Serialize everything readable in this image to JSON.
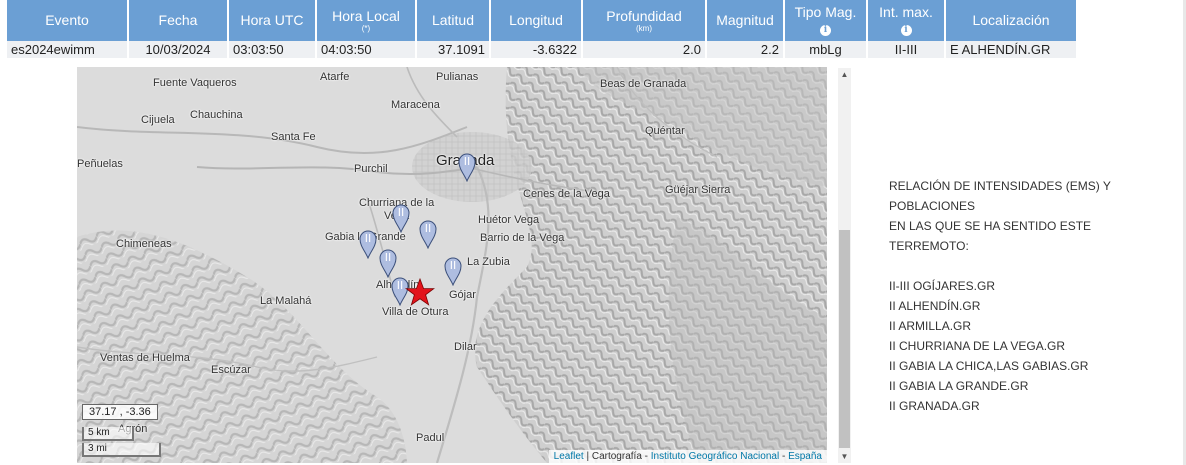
{
  "table": {
    "headers": {
      "evento": "Evento",
      "fecha": "Fecha",
      "hora_utc": "Hora UTC",
      "hora_local": "Hora Local",
      "hora_local_sub": "(*)",
      "latitud": "Latitud",
      "longitud": "Longitud",
      "profundidad": "Profundidad",
      "profundidad_sub": "(km)",
      "magnitud": "Magnitud",
      "tipo_mag": "Tipo Mag.",
      "int_max": "Int. max.",
      "localizacion": "Localización",
      "info_glyph": "i"
    },
    "row": {
      "evento": "es2024ewimm",
      "fecha": "10/03/2024",
      "hora_utc": "03:03:50",
      "hora_local": "04:03:50",
      "latitud": "37.1091",
      "longitud": "-3.6322",
      "profundidad": "2.0",
      "magnitud": "2.2",
      "tipo_mag": "mbLg",
      "int_max": "II-III",
      "localizacion": "E ALHENDÍN.GR"
    }
  },
  "map": {
    "places": {
      "fuente_vaqueros": "Fuente Vaqueros",
      "atarfe": "Atarfe",
      "pulianas": "Pulianas",
      "beas": "Beas de Granada",
      "maracena": "Maracena",
      "cijuela": "Cijuela",
      "chauchina": "Chauchina",
      "santa_fe": "Santa Fe",
      "quentar": "Quéntar",
      "penuelas": "Peñuelas",
      "purchil": "Purchil",
      "granada": "Granada",
      "cenes": "Cenes de la Vega",
      "guejar": "Güéjar Sierra",
      "churriana": "Churriana de la",
      "vega": "Vega",
      "huetor": "Huétor Vega",
      "chimeneas": "Chimeneas",
      "gabia": "Gabia la Grande",
      "barrio": "Barrio de la Vega",
      "zubia": "La Zubia",
      "alhendin": "Alhendín",
      "gojar": "Gójar",
      "malaha": "La Malahá",
      "otura": "Villa de Otura",
      "dilar": "Dilar",
      "ventas": "Ventas de Huelma",
      "escuzar": "Escúzar",
      "agron": "Agrón",
      "padul": "Padul"
    },
    "marker_label": "II",
    "coords": "37.17 , -3.36",
    "scale_km": "5 km",
    "scale_mi": "3 mi",
    "attribution": {
      "leaflet": "Leaflet",
      "sep": " | Cartografía - ",
      "ign": "Instituto Geográfico Nacional",
      "dash": " - ",
      "espana": "España"
    },
    "colors": {
      "marker": "#aebde0",
      "star": "#e3131b"
    }
  },
  "scrollbar": {
    "up_glyph": "▲",
    "down_glyph": "▼"
  },
  "intensities": {
    "heading_lines": [
      "RELACIÓN DE INTENSIDADES (EMS) Y",
      "POBLACIONES",
      "EN LAS QUE SE HA SENTIDO ESTE",
      "TERREMOTO:"
    ],
    "items": [
      "II-III OGÍJARES.GR",
      "II ALHENDÍN.GR",
      "II ARMILLA.GR",
      "II CHURRIANA DE LA VEGA.GR",
      "II GABIA LA CHICA,LAS GABIAS.GR",
      "II GABIA LA GRANDE.GR",
      "II GRANADA.GR"
    ]
  }
}
